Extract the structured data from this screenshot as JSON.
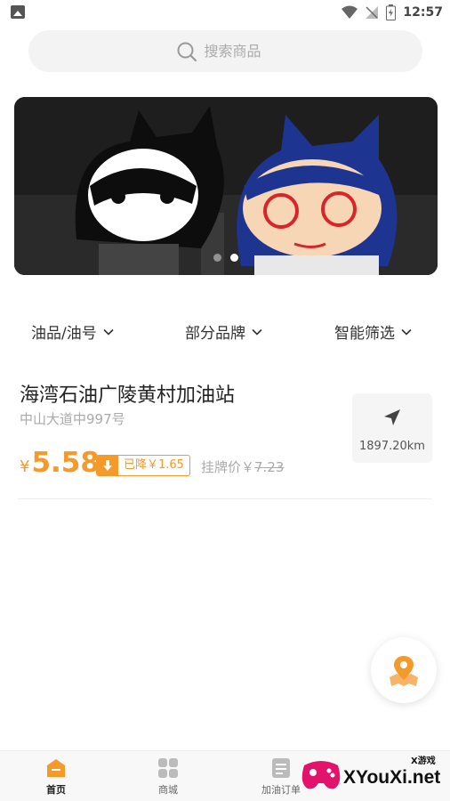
{
  "status_bar": {
    "time": "12:57"
  },
  "search": {
    "placeholder": "搜索商品"
  },
  "filters": [
    {
      "label": "油品/油号"
    },
    {
      "label": "部分品牌"
    },
    {
      "label": "智能筛选"
    }
  ],
  "station": {
    "name": "海湾石油广陵黄村加油站",
    "address": "中山大道中997号",
    "currency": "¥",
    "price": "5.58",
    "discount": "已降￥1.65",
    "list_price_label": "挂牌价￥",
    "list_price": "7.23",
    "distance": "1897.20km"
  },
  "banner": {
    "slide_count": 2,
    "active_slide": 2
  },
  "bottom_nav": [
    {
      "label": "首页",
      "active": true
    },
    {
      "label": "商城",
      "active": false
    },
    {
      "label": "加油订单",
      "active": false
    }
  ],
  "watermark": {
    "text": "XYouXi.net",
    "small": "X游戏"
  },
  "colors": {
    "accent": "#f39a2b",
    "text": "#222222",
    "muted": "#aaaaaa"
  }
}
